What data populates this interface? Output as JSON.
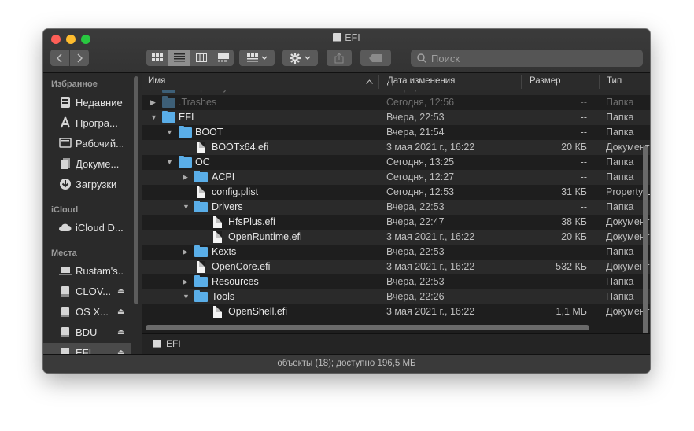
{
  "window": {
    "title": "EFI"
  },
  "toolbar": {
    "search_placeholder": "Поиск"
  },
  "sidebar": {
    "favorites_heading": "Избранное",
    "favorites": [
      {
        "label": "Недавние",
        "icon": "recents-icon"
      },
      {
        "label": "Програ...",
        "icon": "applications-icon"
      },
      {
        "label": "Рабочий...",
        "icon": "desktop-icon"
      },
      {
        "label": "Докуме...",
        "icon": "documents-icon"
      },
      {
        "label": "Загрузки",
        "icon": "downloads-icon"
      }
    ],
    "icloud_heading": "iCloud",
    "icloud": [
      {
        "label": "iCloud D...",
        "icon": "cloud-icon"
      }
    ],
    "locations_heading": "Места",
    "locations": [
      {
        "label": "Rustam's...",
        "icon": "computer-icon",
        "eject": false
      },
      {
        "label": "CLOV...",
        "icon": "disk-icon",
        "eject": true
      },
      {
        "label": "OS X...",
        "icon": "disk-icon",
        "eject": true
      },
      {
        "label": "BDU",
        "icon": "disk-icon",
        "eject": true
      },
      {
        "label": "EFI",
        "icon": "disk-icon",
        "eject": true
      }
    ]
  },
  "columns": {
    "name": "Имя",
    "date": "Дата изменения",
    "size": "Размер",
    "kind": "Тип"
  },
  "files": [
    {
      "name": ".Trashes",
      "date": "Сегодня, 12:56",
      "size": "--",
      "kind": "Папка"
    },
    {
      "name": "EFI",
      "date": "Вчера, 22:53",
      "size": "--",
      "kind": "Папка"
    },
    {
      "name": "BOOT",
      "date": "Вчера, 21:54",
      "size": "--",
      "kind": "Папка"
    },
    {
      "name": "BOOTx64.efi",
      "date": "3 мая 2021 г., 16:22",
      "size": "20 КБ",
      "kind": "Документ"
    },
    {
      "name": "OC",
      "date": "Сегодня, 13:25",
      "size": "--",
      "kind": "Папка"
    },
    {
      "name": "ACPI",
      "date": "Сегодня, 12:27",
      "size": "--",
      "kind": "Папка"
    },
    {
      "name": "config.plist",
      "date": "Сегодня, 12:53",
      "size": "31 КБ",
      "kind": "Property List"
    },
    {
      "name": "Drivers",
      "date": "Вчера, 22:53",
      "size": "--",
      "kind": "Папка"
    },
    {
      "name": "HfsPlus.efi",
      "date": "Вчера, 22:47",
      "size": "38 КБ",
      "kind": "Документ"
    },
    {
      "name": "OpenRuntime.efi",
      "date": "3 мая 2021 г., 16:22",
      "size": "20 КБ",
      "kind": "Документ"
    },
    {
      "name": "Kexts",
      "date": "Вчера, 22:53",
      "size": "--",
      "kind": "Папка"
    },
    {
      "name": "OpenCore.efi",
      "date": "3 мая 2021 г., 16:22",
      "size": "532 КБ",
      "kind": "Документ"
    },
    {
      "name": "Resources",
      "date": "Вчера, 22:53",
      "size": "--",
      "kind": "Папка"
    },
    {
      "name": "Tools",
      "date": "Вчера, 22:26",
      "size": "--",
      "kind": "Папка"
    },
    {
      "name": "OpenShell.efi",
      "date": "3 мая 2021 г., 16:22",
      "size": "1,1 МБ",
      "kind": "Документ"
    }
  ],
  "pathbar": {
    "label": "EFI"
  },
  "status": {
    "text": "объекты (18); доступно 196,5 МБ"
  }
}
